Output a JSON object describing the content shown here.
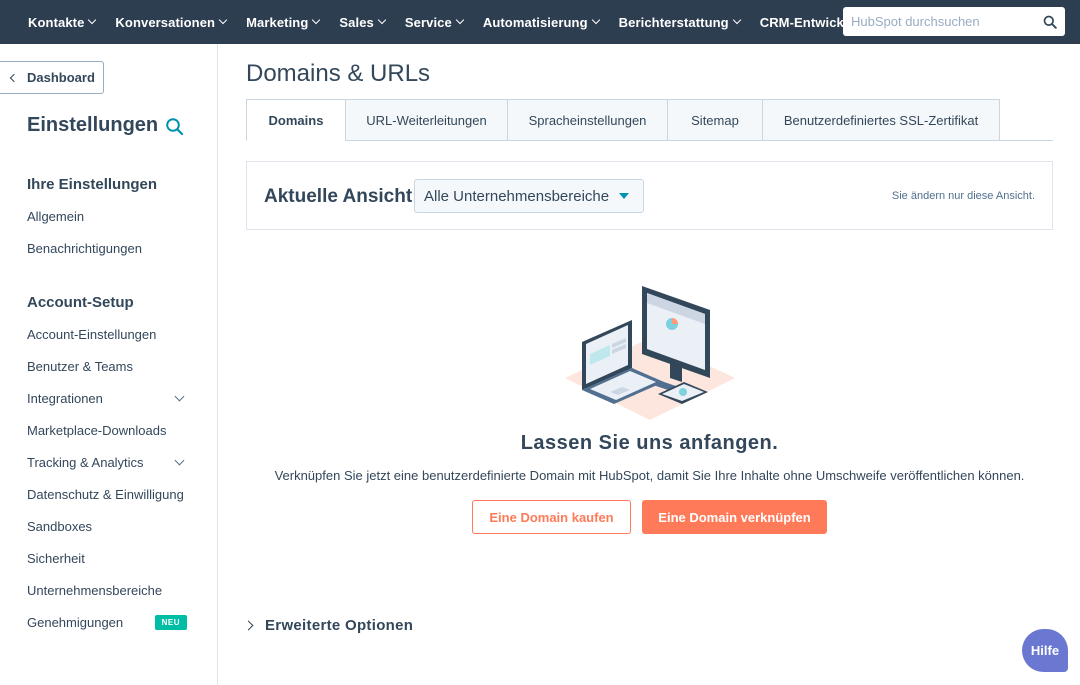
{
  "topnav": {
    "items": [
      {
        "label": "Kontakte",
        "dropdown": true
      },
      {
        "label": "Konversationen",
        "dropdown": true
      },
      {
        "label": "Marketing",
        "dropdown": true
      },
      {
        "label": "Sales",
        "dropdown": true
      },
      {
        "label": "Service",
        "dropdown": true
      },
      {
        "label": "Automatisierung",
        "dropdown": true
      },
      {
        "label": "Berichterstattung",
        "dropdown": true
      },
      {
        "label": "CRM-Entwicklung",
        "dropdown": false
      }
    ],
    "search_placeholder": "HubSpot durchsuchen",
    "search_icon": "magnifier-icon"
  },
  "sidebar": {
    "back_label": "Dashboard",
    "title": "Einstellungen",
    "sections": [
      {
        "heading": "Ihre Einstellungen",
        "items": [
          {
            "label": "Allgemein"
          },
          {
            "label": "Benachrichtigungen"
          }
        ]
      },
      {
        "heading": "Account-Setup",
        "items": [
          {
            "label": "Account-Einstellungen"
          },
          {
            "label": "Benutzer & Teams"
          },
          {
            "label": "Integrationen",
            "expandable": true
          },
          {
            "label": "Marketplace-Downloads"
          },
          {
            "label": "Tracking & Analytics",
            "expandable": true
          },
          {
            "label": "Datenschutz & Einwilligung"
          },
          {
            "label": "Sandboxes"
          },
          {
            "label": "Sicherheit"
          },
          {
            "label": "Unternehmensbereiche"
          },
          {
            "label": "Genehmigungen",
            "badge": "NEU"
          }
        ]
      }
    ]
  },
  "main": {
    "title": "Domains & URLs",
    "tabs": [
      {
        "label": "Domains",
        "active": true
      },
      {
        "label": "URL-Weiterleitungen"
      },
      {
        "label": "Spracheinstellungen"
      },
      {
        "label": "Sitemap"
      },
      {
        "label": "Benutzerdefiniertes SSL-Zertifikat"
      }
    ],
    "view": {
      "label": "Aktuelle Ansicht:",
      "selected": "Alle Unternehmensbereiche",
      "note": "Sie ändern nur diese Ansicht."
    },
    "empty_state": {
      "title": "Lassen Sie uns anfangen.",
      "text": "Verknüpfen Sie jetzt eine benutzerdefinierte Domain mit HubSpot, damit Sie Ihre Inhalte ohne Umschweife veröffentlichen können.",
      "secondary_button": "Eine Domain kaufen",
      "primary_button": "Eine Domain verknüpfen"
    },
    "advanced_label": "Erweiterte Optionen"
  },
  "help_label": "Hilfe",
  "colors": {
    "nav_bg": "#2d3e50",
    "text": "#33475b",
    "accent": "#ff7a59",
    "teal": "#00bda5",
    "help": "#6a78d1"
  }
}
